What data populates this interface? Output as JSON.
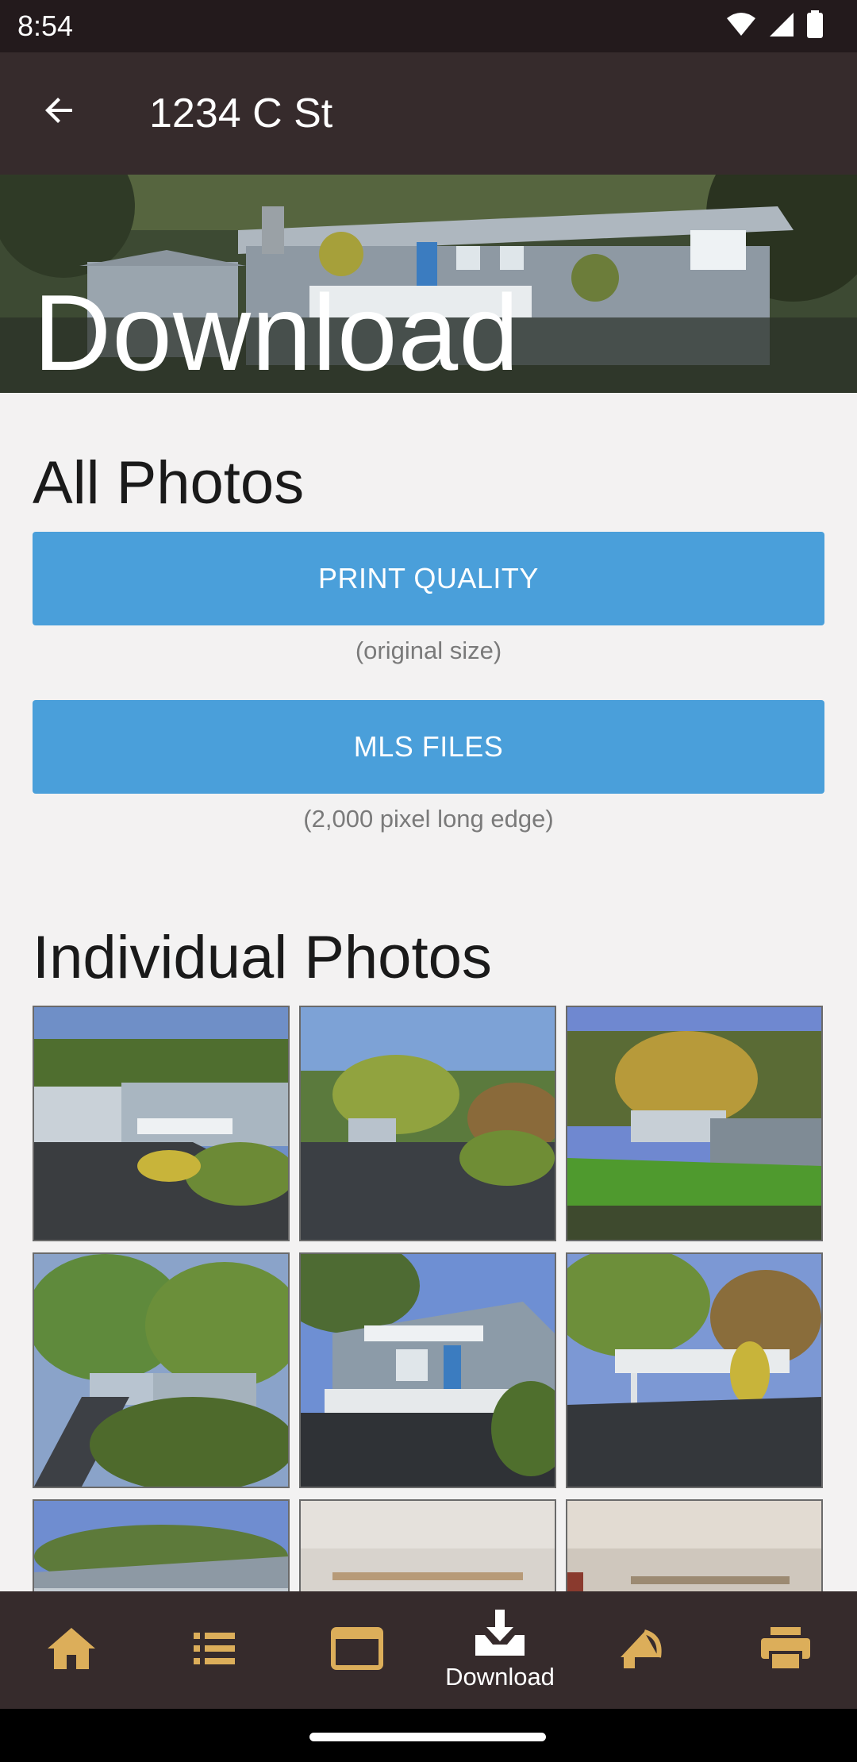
{
  "status_bar": {
    "time": "8:54",
    "icons": [
      "wifi-icon",
      "signal-icon",
      "battery-icon"
    ]
  },
  "app_bar": {
    "title": "1234 C St",
    "back_icon": "arrow-back-icon"
  },
  "hero": {
    "title": "Download"
  },
  "all_photos": {
    "heading": "All Photos",
    "print_quality": {
      "label": "PRINT QUALITY",
      "caption": "(original size)"
    },
    "mls_files": {
      "label": "MLS FILES",
      "caption": "(2,000 pixel long edge)"
    }
  },
  "individual_photos": {
    "heading": "Individual Photos",
    "photos": [
      "exterior-driveway",
      "front-garden",
      "backyard-lawn",
      "willow-driveway",
      "front-porch",
      "deck",
      "house-side",
      "interior-room",
      "interior-room"
    ]
  },
  "bottom_nav": {
    "items": [
      {
        "icon": "home-icon",
        "label": ""
      },
      {
        "icon": "list-icon",
        "label": ""
      },
      {
        "icon": "browser-window-icon",
        "label": ""
      },
      {
        "icon": "download-icon",
        "label": "Download",
        "active": true
      },
      {
        "icon": "megaphone-icon",
        "label": ""
      },
      {
        "icon": "printer-icon",
        "label": ""
      }
    ]
  },
  "colors": {
    "accent": "#4a9fda",
    "nav_icon": "#dcae5a",
    "bar": "#362b2c",
    "background": "#f3f2f2"
  }
}
